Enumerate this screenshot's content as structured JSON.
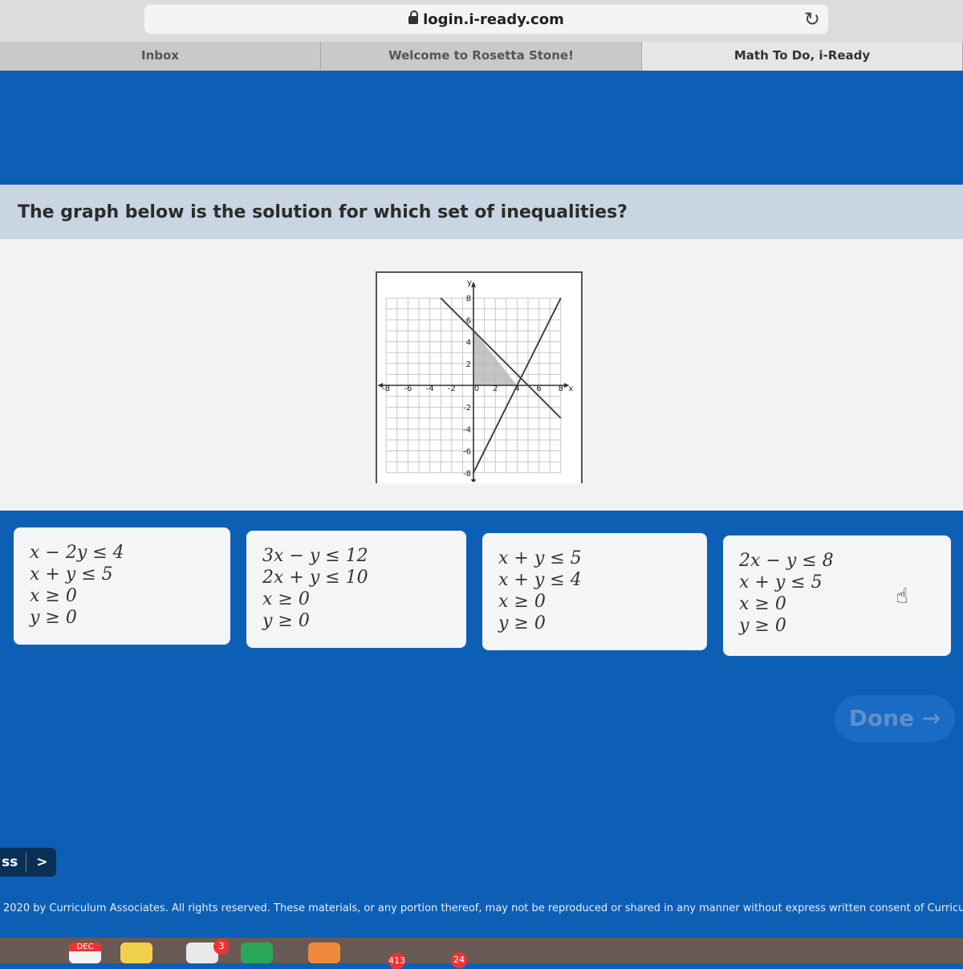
{
  "browser": {
    "url": "login.i-ready.com",
    "tabs": [
      "Inbox",
      "Welcome to Rosetta Stone!",
      "Math To Do, i-Ready"
    ]
  },
  "question": {
    "text": "The graph below is the solution for which set of inequalities?"
  },
  "graph": {
    "x_ticks": [
      "-8",
      "-6",
      "-4",
      "-2",
      "0",
      "2",
      "4",
      "6",
      "8"
    ],
    "y_ticks": [
      "8",
      "6",
      "4",
      "2",
      "-2",
      "-4",
      "-6",
      "-8"
    ],
    "x_label": "x",
    "y_label": "y",
    "lines": [
      {
        "x": [
          -3,
          8
        ],
        "y": [
          8,
          -3
        ]
      },
      {
        "x": [
          0,
          8
        ],
        "y": [
          -8,
          8
        ]
      }
    ],
    "shaded_region": {
      "x": [
        0,
        0,
        4
      ],
      "y": [
        0,
        5,
        0
      ]
    }
  },
  "choices": [
    [
      "x − 2y ≤ 4",
      "x + y ≤ 5",
      "x ≥ 0",
      "y ≥ 0"
    ],
    [
      "3x − y ≤ 12",
      "2x + y ≤ 10",
      "x ≥ 0",
      "y ≥ 0"
    ],
    [
      "x + y ≤ 5",
      "x + y ≤ 4",
      "x ≥ 0",
      "y ≥ 0"
    ],
    [
      "2x − y ≤ 8",
      "x + y ≤ 5",
      "x ≥ 0",
      "y ≥ 0"
    ]
  ],
  "done_button": {
    "label": "Done →"
  },
  "nav": {
    "label": "ss",
    "arrow": ">"
  },
  "footer": {
    "copyright": "2020 by Curriculum Associates. All rights reserved. These materials, or any portion thereof, may not be reproduced or shared in any manner without express written consent of Curriculum"
  },
  "dock": {
    "calendar_label": "DEC",
    "badges": [
      "3",
      "413",
      "24"
    ]
  }
}
